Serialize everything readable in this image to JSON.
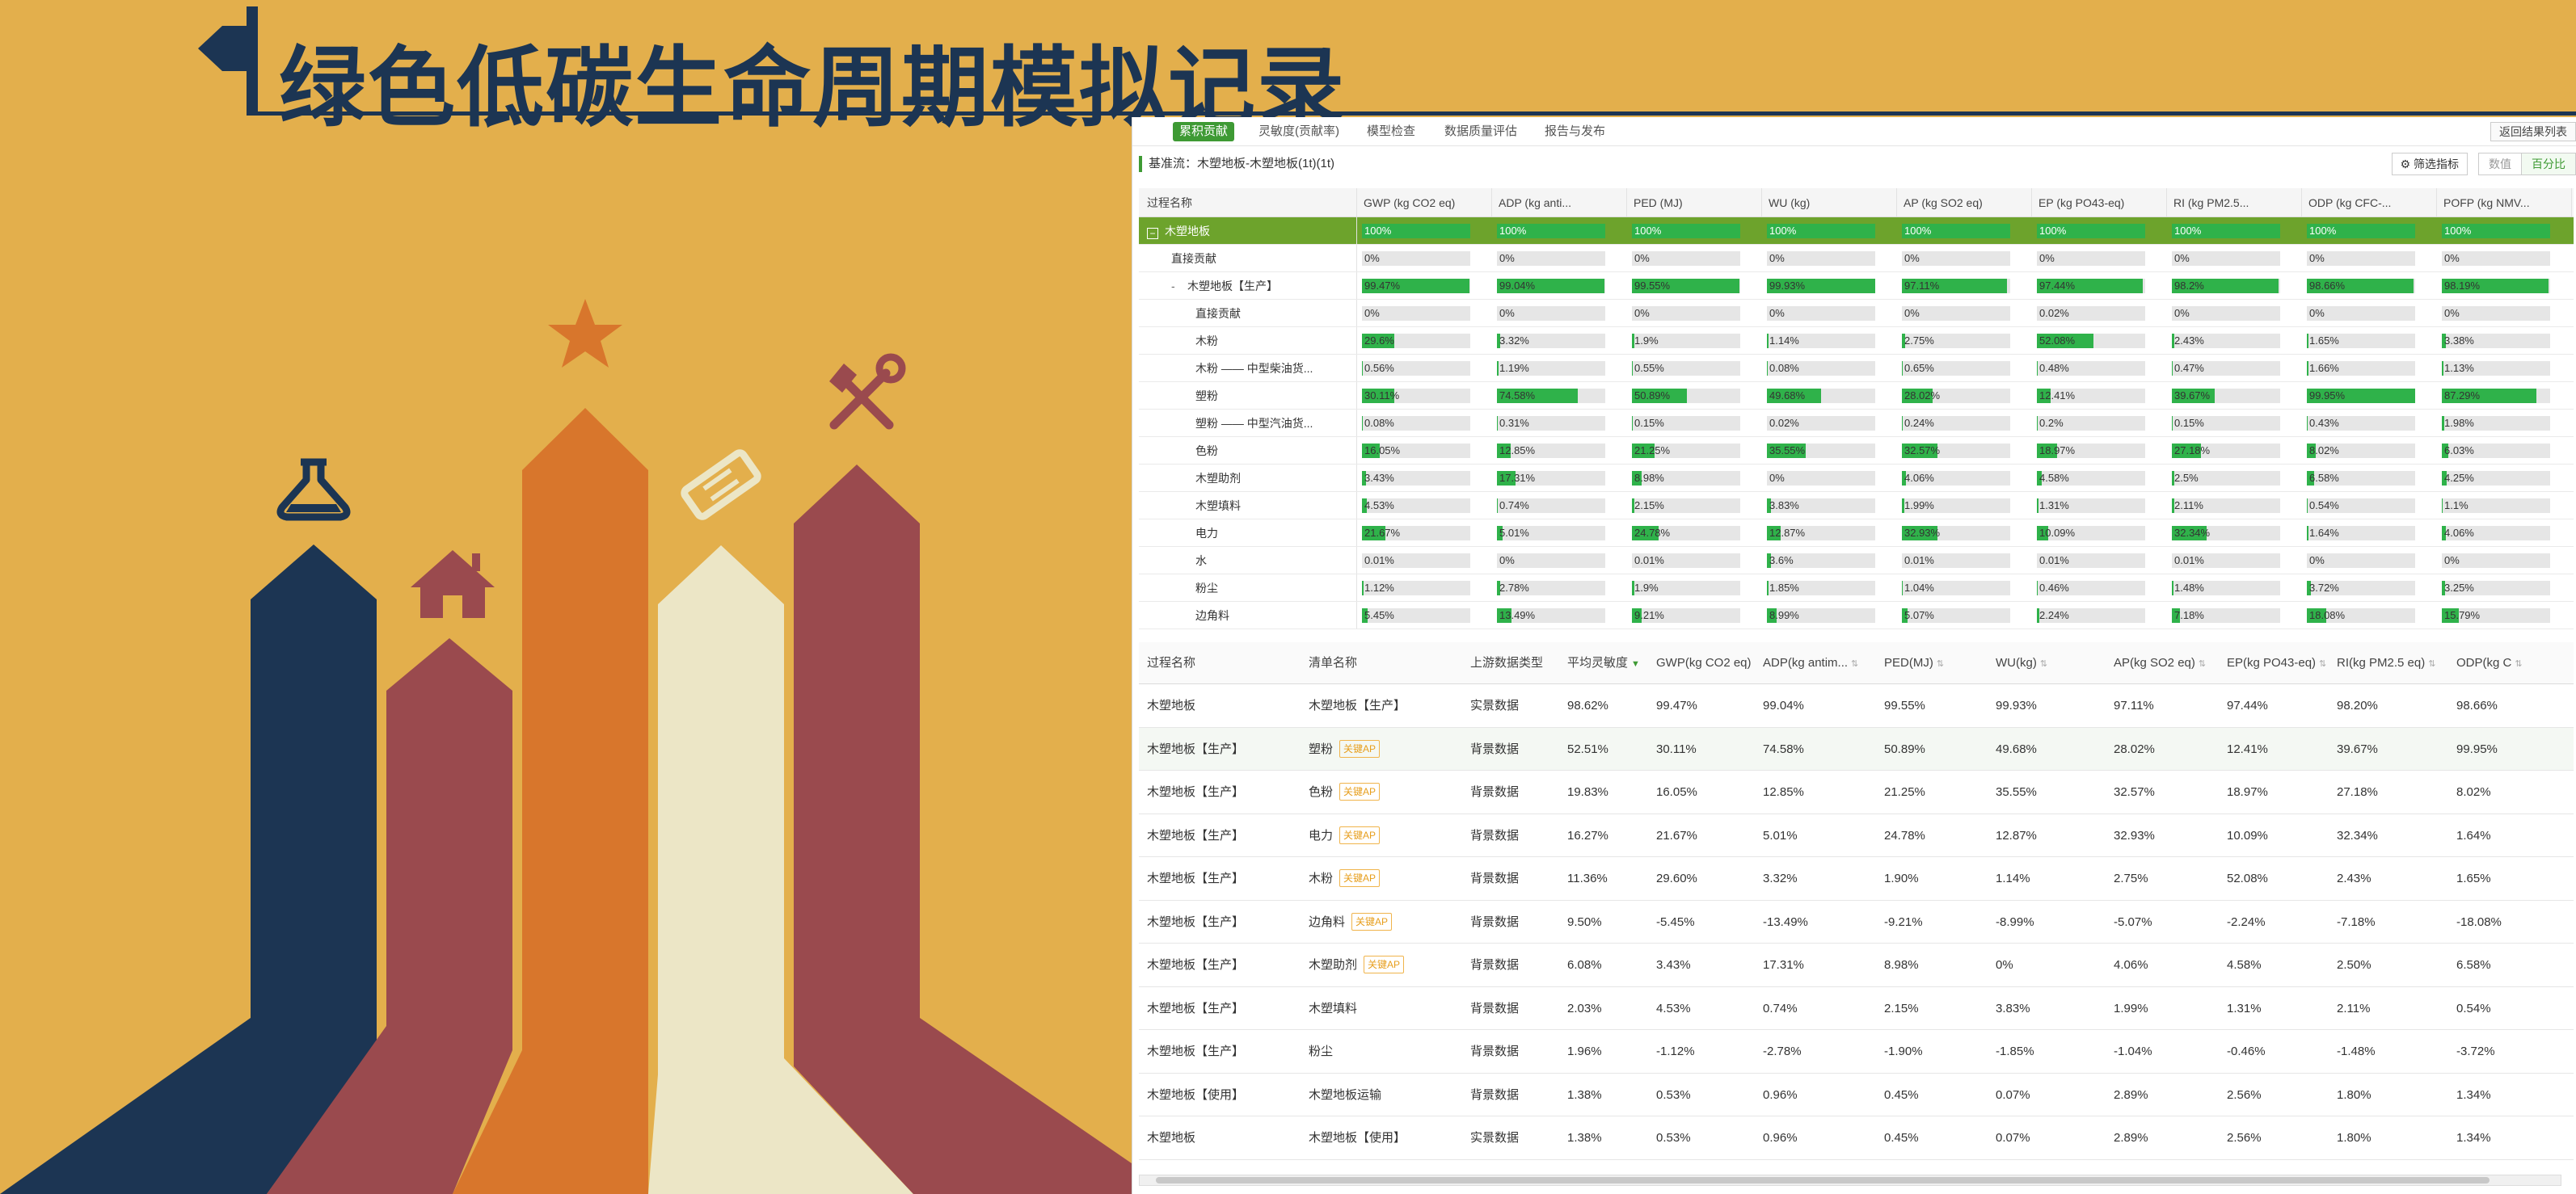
{
  "slide": {
    "title": "绿色低碳生命周期模拟记录",
    "colors": {
      "background": "#e3af4c",
      "navy": "#1c3553",
      "maroon": "#9a4a4e",
      "orange": "#d8762c",
      "cream": "#ece6c6"
    },
    "icons": [
      "flag-icon",
      "flask-icon",
      "house-icon",
      "star-icon",
      "ticket-icon",
      "tools-icon"
    ]
  },
  "app": {
    "tabs": [
      "累积贡献",
      "灵敏度(贡献率)",
      "模型检查",
      "数据质量评估",
      "报告与发布"
    ],
    "active_tab": 0,
    "back_button": "返回结果列表",
    "baseline": "基准流：木塑地板-木塑地板(1t)(1t)",
    "filter_button": "筛选指标",
    "view_toggle": [
      "数值",
      "百分比"
    ],
    "colors": {
      "accent": "#3e9a34",
      "bar_fill": "#2fb24a",
      "root_row": "#6da32c",
      "tag": "#e79e1c"
    }
  },
  "tree": {
    "columns": [
      "过程名称",
      "GWP (kg CO2 eq)",
      "ADP (kg anti...",
      "PED (MJ)",
      "WU (kg)",
      "AP (kg SO2 eq)",
      "EP (kg PO43-eq)",
      "RI (kg PM2.5...",
      "ODP (kg CFC-...",
      "POFP (kg NMV..."
    ],
    "rows": [
      {
        "name": "木塑地板",
        "level": 0,
        "kind": "root",
        "values": [
          "100%",
          "100%",
          "100%",
          "100%",
          "100%",
          "100%",
          "100%",
          "100%",
          "100%"
        ],
        "pct": [
          100,
          100,
          100,
          100,
          100,
          100,
          100,
          100,
          100
        ]
      },
      {
        "name": "直接贡献",
        "level": 1,
        "values": [
          "0%",
          "0%",
          "0%",
          "0%",
          "0%",
          "0%",
          "0%",
          "0%",
          "0%"
        ],
        "pct": [
          0,
          0,
          0,
          0,
          0,
          0,
          0,
          0,
          0
        ]
      },
      {
        "name": "木塑地板【生产】",
        "level": 1,
        "kind": "group",
        "values": [
          "99.47%",
          "99.04%",
          "99.55%",
          "99.93%",
          "97.11%",
          "97.44%",
          "98.2%",
          "98.66%",
          "98.19%"
        ],
        "pct": [
          99.47,
          99.04,
          99.55,
          99.93,
          97.11,
          97.44,
          98.2,
          98.66,
          98.19
        ]
      },
      {
        "name": "直接贡献",
        "level": 2,
        "values": [
          "0%",
          "0%",
          "0%",
          "0%",
          "0%",
          "0.02%",
          "0%",
          "0%",
          "0%"
        ],
        "pct": [
          0,
          0,
          0,
          0,
          0,
          0.02,
          0,
          0,
          0
        ]
      },
      {
        "name": "木粉",
        "level": 2,
        "values": [
          "29.6%",
          "3.32%",
          "1.9%",
          "1.14%",
          "2.75%",
          "52.08%",
          "2.43%",
          "1.65%",
          "3.38%"
        ],
        "pct": [
          29.6,
          3.32,
          1.9,
          1.14,
          2.75,
          52.08,
          2.43,
          1.65,
          3.38
        ]
      },
      {
        "name": "木粉 —— 中型柴油货...",
        "level": 2,
        "values": [
          "0.56%",
          "1.19%",
          "0.55%",
          "0.08%",
          "0.65%",
          "0.48%",
          "0.47%",
          "1.66%",
          "1.13%"
        ],
        "pct": [
          0.56,
          1.19,
          0.55,
          0.08,
          0.65,
          0.48,
          0.47,
          1.66,
          1.13
        ]
      },
      {
        "name": "塑粉",
        "level": 2,
        "values": [
          "30.11%",
          "74.58%",
          "50.89%",
          "49.68%",
          "28.02%",
          "12.41%",
          "39.67%",
          "99.95%",
          "87.29%"
        ],
        "pct": [
          30.11,
          74.58,
          50.89,
          49.68,
          28.02,
          12.41,
          39.67,
          99.95,
          87.29
        ]
      },
      {
        "name": "塑粉 —— 中型汽油货...",
        "level": 2,
        "values": [
          "0.08%",
          "0.31%",
          "0.15%",
          "0.02%",
          "0.24%",
          "0.2%",
          "0.15%",
          "0.43%",
          "1.98%"
        ],
        "pct": [
          0.08,
          0.31,
          0.15,
          0.02,
          0.24,
          0.2,
          0.15,
          0.43,
          1.98
        ]
      },
      {
        "name": "色粉",
        "level": 2,
        "values": [
          "16.05%",
          "12.85%",
          "21.25%",
          "35.55%",
          "32.57%",
          "18.97%",
          "27.18%",
          "8.02%",
          "6.03%"
        ],
        "pct": [
          16.05,
          12.85,
          21.25,
          35.55,
          32.57,
          18.97,
          27.18,
          8.02,
          6.03
        ]
      },
      {
        "name": "木塑助剂",
        "level": 2,
        "values": [
          "3.43%",
          "17.31%",
          "8.98%",
          "0%",
          "4.06%",
          "4.58%",
          "2.5%",
          "6.58%",
          "4.25%"
        ],
        "pct": [
          3.43,
          17.31,
          8.98,
          0,
          4.06,
          4.58,
          2.5,
          6.58,
          4.25
        ]
      },
      {
        "name": "木塑填料",
        "level": 2,
        "values": [
          "4.53%",
          "0.74%",
          "2.15%",
          "3.83%",
          "1.99%",
          "1.31%",
          "2.11%",
          "0.54%",
          "1.1%"
        ],
        "pct": [
          4.53,
          0.74,
          2.15,
          3.83,
          1.99,
          1.31,
          2.11,
          0.54,
          1.1
        ]
      },
      {
        "name": "电力",
        "level": 2,
        "values": [
          "21.67%",
          "5.01%",
          "24.78%",
          "12.87%",
          "32.93%",
          "10.09%",
          "32.34%",
          "1.64%",
          "4.06%"
        ],
        "pct": [
          21.67,
          5.01,
          24.78,
          12.87,
          32.93,
          10.09,
          32.34,
          1.64,
          4.06
        ]
      },
      {
        "name": "水",
        "level": 2,
        "values": [
          "0.01%",
          "0%",
          "0.01%",
          "3.6%",
          "0.01%",
          "0.01%",
          "0.01%",
          "0%",
          "0%"
        ],
        "pct": [
          0.01,
          0,
          0.01,
          3.6,
          0.01,
          0.01,
          0.01,
          0,
          0
        ]
      },
      {
        "name": "粉尘",
        "level": 2,
        "values": [
          "1.12%",
          "2.78%",
          "1.9%",
          "1.85%",
          "1.04%",
          "0.46%",
          "1.48%",
          "3.72%",
          "3.25%"
        ],
        "pct": [
          1.12,
          2.78,
          1.9,
          1.85,
          1.04,
          0.46,
          1.48,
          3.72,
          3.25
        ]
      },
      {
        "name": "边角料",
        "level": 2,
        "values": [
          "5.45%",
          "13.49%",
          "9.21%",
          "8.99%",
          "5.07%",
          "2.24%",
          "7.18%",
          "18.08%",
          "15.79%"
        ],
        "pct": [
          5.45,
          13.49,
          9.21,
          8.99,
          5.07,
          2.24,
          7.18,
          18.08,
          15.79
        ]
      }
    ]
  },
  "detail": {
    "columns": [
      "过程名称",
      "清单名称",
      "上游数据类型",
      "平均灵敏度",
      "GWP(kg CO2 eq)",
      "ADP(kg antim...",
      "PED(MJ)",
      "WU(kg)",
      "AP(kg SO2 eq)",
      "EP(kg PO43-eq)",
      "RI(kg PM2.5 eq)",
      "ODP(kg C"
    ],
    "sorted_column": 3,
    "key_tag": "关键AP",
    "rows": [
      {
        "process": "木塑地板",
        "item": "木塑地板【生产】",
        "tag": false,
        "type": "实景数据",
        "values": [
          "98.62%",
          "99.47%",
          "99.04%",
          "99.55%",
          "99.93%",
          "97.11%",
          "97.44%",
          "98.20%",
          "98.66%"
        ]
      },
      {
        "process": "木塑地板【生产】",
        "item": "塑粉",
        "tag": true,
        "type": "背景数据",
        "values": [
          "52.51%",
          "30.11%",
          "74.58%",
          "50.89%",
          "49.68%",
          "28.02%",
          "12.41%",
          "39.67%",
          "99.95%"
        ]
      },
      {
        "process": "木塑地板【生产】",
        "item": "色粉",
        "tag": true,
        "type": "背景数据",
        "values": [
          "19.83%",
          "16.05%",
          "12.85%",
          "21.25%",
          "35.55%",
          "32.57%",
          "18.97%",
          "27.18%",
          "8.02%"
        ]
      },
      {
        "process": "木塑地板【生产】",
        "item": "电力",
        "tag": true,
        "type": "背景数据",
        "values": [
          "16.27%",
          "21.67%",
          "5.01%",
          "24.78%",
          "12.87%",
          "32.93%",
          "10.09%",
          "32.34%",
          "1.64%"
        ]
      },
      {
        "process": "木塑地板【生产】",
        "item": "木粉",
        "tag": true,
        "type": "背景数据",
        "values": [
          "11.36%",
          "29.60%",
          "3.32%",
          "1.90%",
          "1.14%",
          "2.75%",
          "52.08%",
          "2.43%",
          "1.65%"
        ]
      },
      {
        "process": "木塑地板【生产】",
        "item": "边角料",
        "tag": true,
        "type": "背景数据",
        "values": [
          "9.50%",
          "-5.45%",
          "-13.49%",
          "-9.21%",
          "-8.99%",
          "-5.07%",
          "-2.24%",
          "-7.18%",
          "-18.08%"
        ]
      },
      {
        "process": "木塑地板【生产】",
        "item": "木塑助剂",
        "tag": true,
        "type": "背景数据",
        "values": [
          "6.08%",
          "3.43%",
          "17.31%",
          "8.98%",
          "0%",
          "4.06%",
          "4.58%",
          "2.50%",
          "6.58%"
        ]
      },
      {
        "process": "木塑地板【生产】",
        "item": "木塑填料",
        "tag": false,
        "type": "背景数据",
        "values": [
          "2.03%",
          "4.53%",
          "0.74%",
          "2.15%",
          "3.83%",
          "1.99%",
          "1.31%",
          "2.11%",
          "0.54%"
        ]
      },
      {
        "process": "木塑地板【生产】",
        "item": "粉尘",
        "tag": false,
        "type": "背景数据",
        "values": [
          "1.96%",
          "-1.12%",
          "-2.78%",
          "-1.90%",
          "-1.85%",
          "-1.04%",
          "-0.46%",
          "-1.48%",
          "-3.72%"
        ]
      },
      {
        "process": "木塑地板【使用】",
        "item": "木塑地板运输",
        "tag": false,
        "type": "背景数据",
        "values": [
          "1.38%",
          "0.53%",
          "0.96%",
          "0.45%",
          "0.07%",
          "2.89%",
          "2.56%",
          "1.80%",
          "1.34%"
        ]
      },
      {
        "process": "木塑地板",
        "item": "木塑地板【使用】",
        "tag": false,
        "type": "实景数据",
        "values": [
          "1.38%",
          "0.53%",
          "0.96%",
          "0.45%",
          "0.07%",
          "2.89%",
          "2.56%",
          "1.80%",
          "1.34%"
        ]
      }
    ]
  }
}
